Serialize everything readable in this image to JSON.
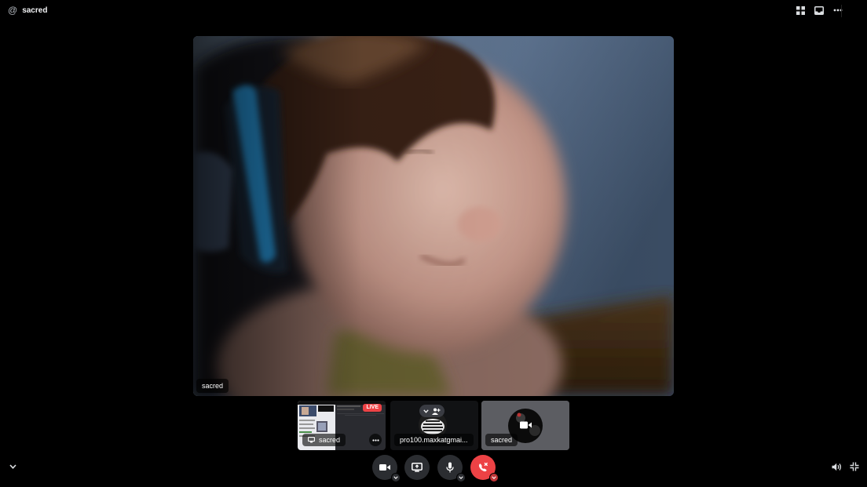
{
  "header": {
    "at_symbol": "@",
    "channel_name": "sacred"
  },
  "main_video": {
    "participant": "sacred"
  },
  "tiles": [
    {
      "label": "sacred",
      "badge": "LIVE"
    },
    {
      "label": "pro100.maxkatgmai..."
    },
    {
      "label": "sacred"
    }
  ],
  "colors": {
    "background": "#000000",
    "control_bg": "#2b2d31",
    "danger": "#ed4245",
    "live": "#ed4245"
  },
  "icons": {
    "top_bar": [
      "grid-icon",
      "inbox-icon",
      "more-icon"
    ],
    "controls": [
      "camera-icon",
      "screen-share-icon",
      "microphone-icon",
      "hang-up-icon"
    ],
    "corners": [
      "chevron-down-icon",
      "volume-icon",
      "exit-fullscreen-icon"
    ]
  }
}
